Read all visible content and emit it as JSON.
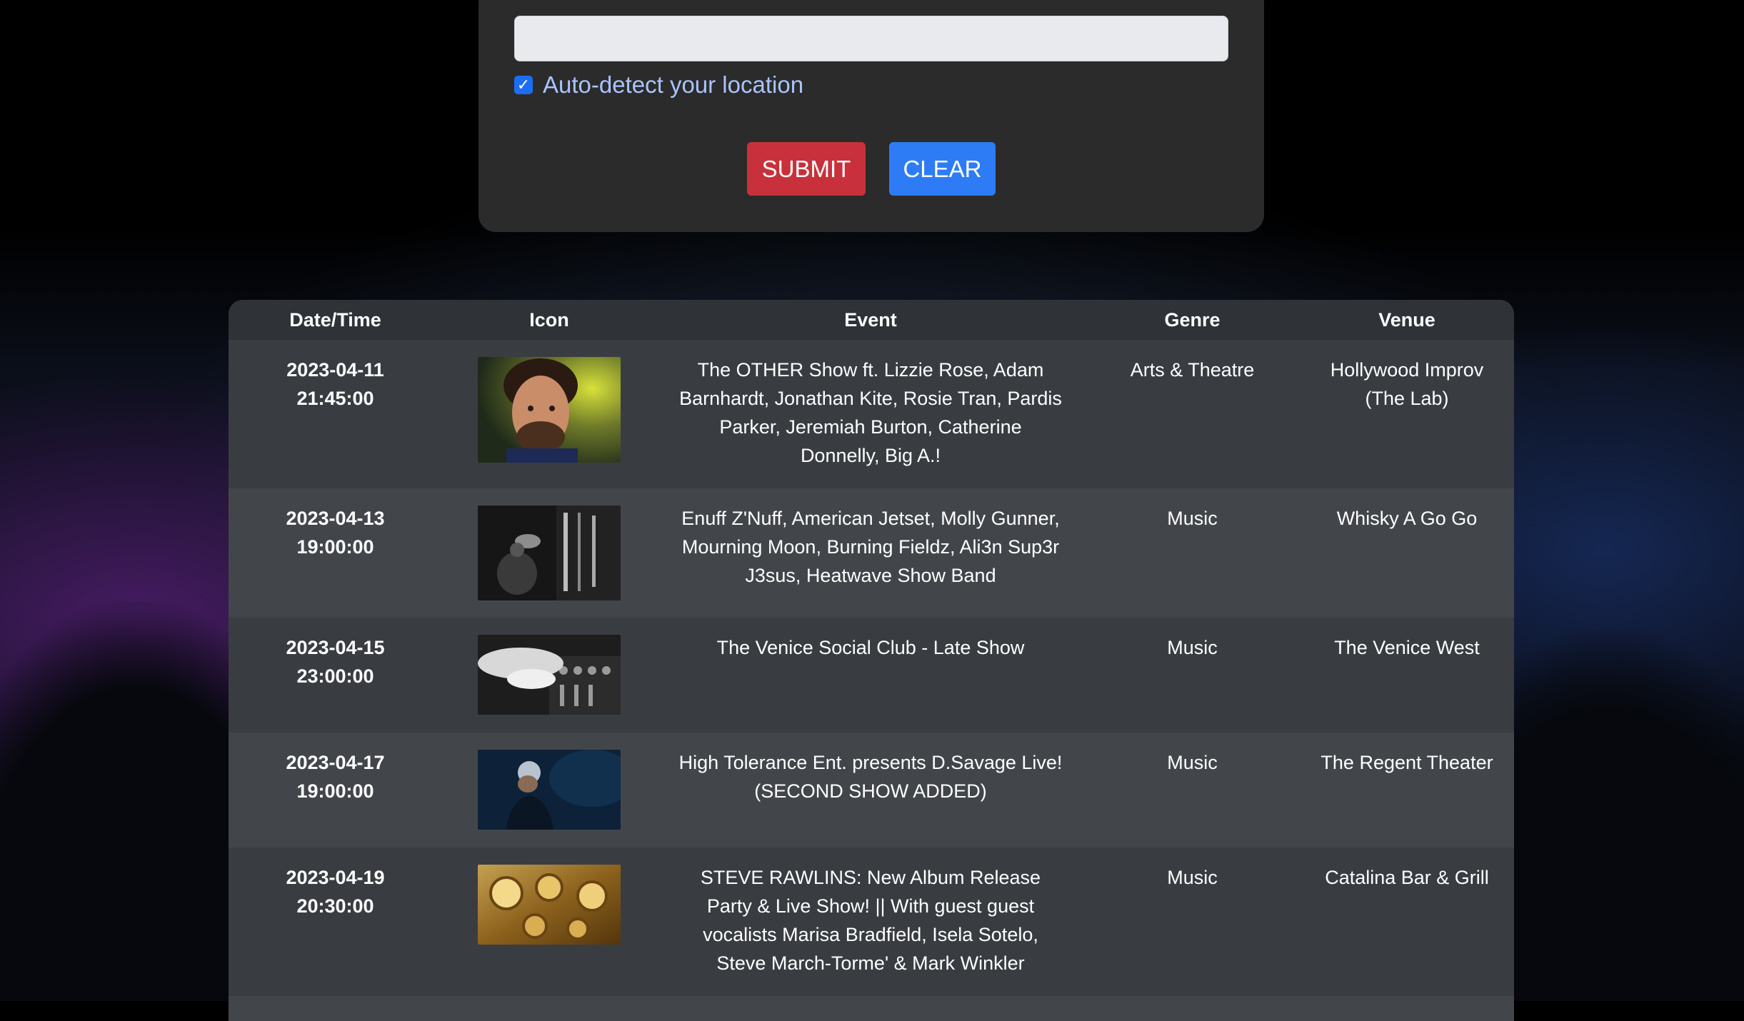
{
  "search": {
    "location_value": "",
    "auto_detect_label": "Auto-detect your location",
    "auto_detect_checked": true,
    "submit_label": "SUBMIT",
    "clear_label": "CLEAR"
  },
  "colors": {
    "submit": "#c8313b",
    "clear": "#2d7cf5",
    "checkbox": "#1b6ef3",
    "auto_label": "#a9c4ff"
  },
  "table": {
    "headers": [
      "Date/Time",
      "Icon",
      "Event",
      "Genre",
      "Venue"
    ],
    "rows": [
      {
        "date": "2023-04-11",
        "time": "21:45:00",
        "icon": "comedian-portrait-image",
        "event": "The OTHER Show ft. Lizzie Rose, Adam Barnhardt, Jonathan Kite, Rosie Tran, Pardis Parker, Jeremiah Burton, Catherine Donnelly, Big A.!",
        "genre": "Arts & Theatre",
        "venue": "Hollywood Improv (The Lab)"
      },
      {
        "date": "2023-04-13",
        "time": "19:00:00",
        "icon": "concert-stage-image",
        "event": "Enuff Z'Nuff, American Jetset, Molly Gunner, Mourning Moon, Burning Fieldz, Ali3n Sup3r J3sus, Heatwave Show Band",
        "genre": "Music",
        "venue": "Whisky A Go Go"
      },
      {
        "date": "2023-04-15",
        "time": "23:00:00",
        "icon": "dj-mixer-image",
        "event": "The Venice Social Club - Late Show",
        "genre": "Music",
        "venue": "The Venice West"
      },
      {
        "date": "2023-04-17",
        "time": "19:00:00",
        "icon": "performer-blue-stage-image",
        "event": "High Tolerance Ent. presents D.Savage Live! (SECOND SHOW ADDED)",
        "genre": "Music",
        "venue": "The Regent Theater"
      },
      {
        "date": "2023-04-19",
        "time": "20:30:00",
        "icon": "saxophone-image",
        "event": "STEVE RAWLINS: New Album Release Party & Live Show! || With guest guest vocalists Marisa Bradfield, Isela Sotelo, Steve March-Torme' & Mark Winkler",
        "genre": "Music",
        "venue": "Catalina Bar & Grill"
      }
    ]
  }
}
